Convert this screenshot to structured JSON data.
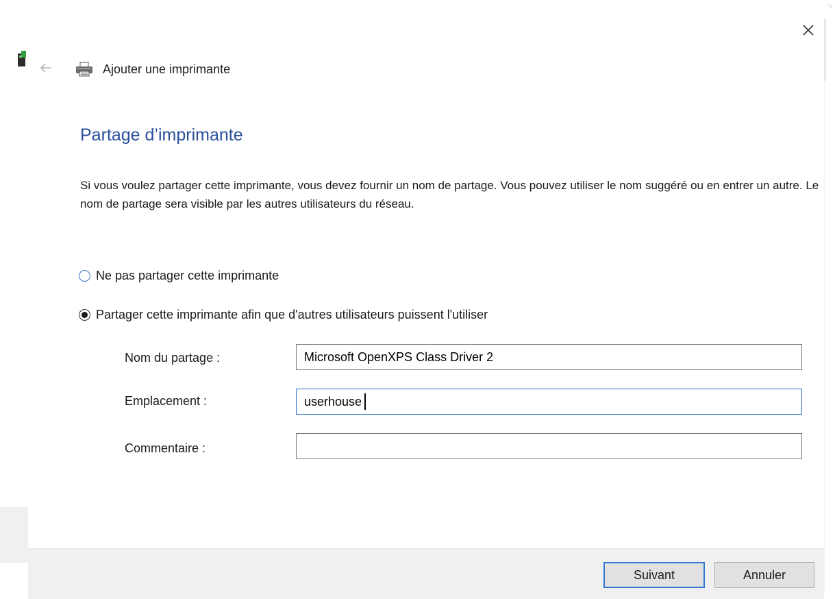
{
  "header": {
    "title": "Ajouter une imprimante",
    "close_icon": "close-icon",
    "back_icon": "back-arrow-icon",
    "printer_icon": "printer-icon",
    "app_icon": "app-icon"
  },
  "page": {
    "title": "Partage d’imprimante",
    "description": "Si vous voulez partager cette imprimante, vous devez fournir un nom de partage. Vous pouvez utiliser le nom suggéré ou en entrer un autre. Le nom de partage sera visible par les autres utilisateurs du réseau."
  },
  "options": [
    {
      "label": "Ne pas partager cette imprimante",
      "selected": false
    },
    {
      "label": "Partager cette imprimante afin que d'autres utilisateurs puissent l'utiliser",
      "selected": true
    }
  ],
  "fields": {
    "share_name": {
      "label": "Nom du partage :",
      "value": "Microsoft OpenXPS Class Driver 2"
    },
    "location": {
      "label": "Emplacement :",
      "value": "userhouse"
    },
    "comment": {
      "label": "Commentaire :",
      "value": ""
    }
  },
  "buttons": {
    "next": "Suivant",
    "cancel": "Annuler"
  },
  "colors": {
    "title_blue": "#2a4f9c",
    "focus_blue": "#2f70c9",
    "footer_bg": "#f0f0f0"
  }
}
